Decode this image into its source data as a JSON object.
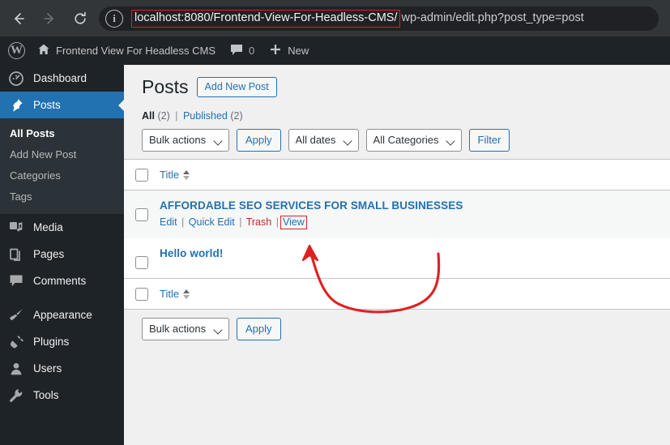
{
  "browser": {
    "back_icon": "arrow-left-icon",
    "forward_icon": "arrow-right-icon",
    "reload_icon": "reload-icon",
    "site_info_icon": "info-circle-icon",
    "url_host": "localhost:8080/Frontend-View-For-Headless-CMS/",
    "url_path": "wp-admin/edit.php?post_type=post",
    "highlight_color": "#e02020"
  },
  "adminbar": {
    "logo_icon": "wordpress-logo-icon",
    "home_icon": "home-icon",
    "site_name": "Frontend View For Headless CMS",
    "comments_icon": "comment-bubble-icon",
    "comments_count": "0",
    "new_icon": "plus-icon",
    "new_label": "New"
  },
  "sidebar": {
    "items": [
      {
        "label": "Dashboard",
        "icon": "dashboard-gauge-icon",
        "current": false
      },
      {
        "label": "Posts",
        "icon": "pin-icon",
        "current": true
      },
      {
        "label": "Media",
        "icon": "media-music-icon",
        "current": false
      },
      {
        "label": "Pages",
        "icon": "pages-icon",
        "current": false
      },
      {
        "label": "Comments",
        "icon": "comment-bubble-icon",
        "current": false
      },
      {
        "label": "Appearance",
        "icon": "paintbrush-icon",
        "current": false
      },
      {
        "label": "Plugins",
        "icon": "plug-icon",
        "current": false
      },
      {
        "label": "Users",
        "icon": "user-icon",
        "current": false
      },
      {
        "label": "Tools",
        "icon": "wrench-icon",
        "current": false
      }
    ],
    "submenu": [
      {
        "label": "All Posts",
        "current": true
      },
      {
        "label": "Add New Post",
        "current": false
      },
      {
        "label": "Categories",
        "current": false
      },
      {
        "label": "Tags",
        "current": false
      }
    ],
    "accent_color": "#2271b1",
    "background_color": "#1d2327"
  },
  "main": {
    "page_title": "Posts",
    "add_new_label": "Add New Post",
    "views": {
      "all_label": "All",
      "all_count": "(2)",
      "separator": "|",
      "published_label": "Published",
      "published_count": "(2)"
    },
    "tablenav_top": {
      "bulk_actions": "Bulk actions",
      "apply_label": "Apply",
      "all_dates": "All dates",
      "all_categories": "All Categories",
      "filter_label": "Filter"
    },
    "table": {
      "column_title": "Title",
      "rows": [
        {
          "title": "AFFORDABLE SEO SERVICES FOR SMALL BUSINESSES",
          "actions": {
            "edit": "Edit",
            "quick_edit": "Quick Edit",
            "trash": "Trash",
            "view": "View",
            "separator": "|"
          }
        },
        {
          "title": "Hello world!"
        }
      ]
    },
    "tablenav_bottom": {
      "bulk_actions": "Bulk actions",
      "apply_label": "Apply"
    }
  },
  "annotation": {
    "arrow_color": "#e02020",
    "description": "red hand-drawn arrow pointing to View link"
  }
}
